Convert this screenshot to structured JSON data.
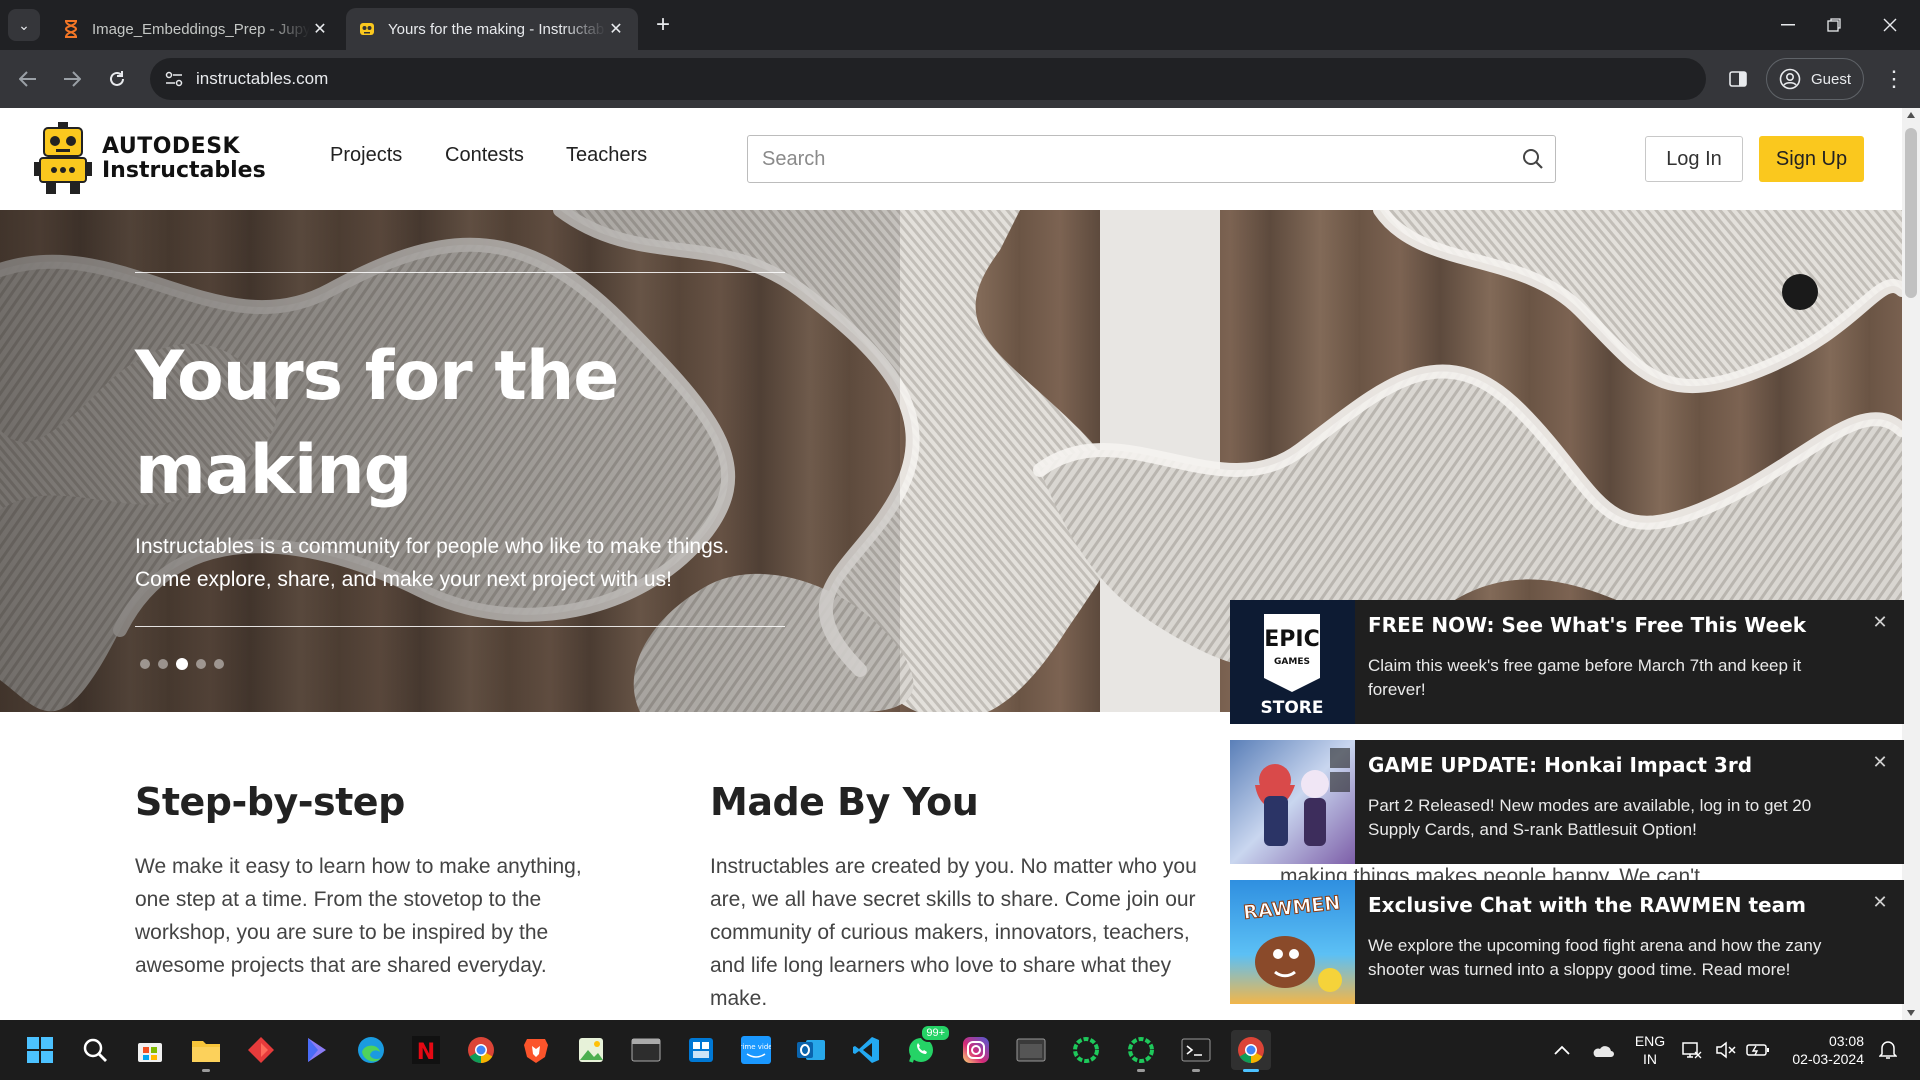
{
  "browser": {
    "tabs": [
      {
        "title": "Image_Embeddings_Prep - Jupyter",
        "active": false
      },
      {
        "title": "Yours for the making - Instructables",
        "active": true
      }
    ],
    "url": "instructables.com",
    "profile_label": "Guest"
  },
  "site": {
    "logo_top": "AUTODESK",
    "logo_bottom": "Instructables",
    "nav": [
      "Projects",
      "Contests",
      "Teachers"
    ],
    "search_placeholder": "Search",
    "login_label": "Log In",
    "signup_label": "Sign Up",
    "accent_color": "#fac81e"
  },
  "hero": {
    "title": "Yours for the making",
    "subtitle_line1": "Instructables is a community for people who like to make things.",
    "subtitle_line2": "Come explore, share, and make your next project with us!",
    "slides": 5,
    "active_slide": 3
  },
  "features": [
    {
      "title": "Step-by-step",
      "text": "We make it easy to learn how to make anything, one step at a time. From the stovetop to the workshop, you are sure to be inspired by the awesome projects that are shared everyday."
    },
    {
      "title": "Made By You",
      "text": "Instructables are created by you. No matter who you are, we all have secret skills to share. Come join our community of curious makers, innovators, teachers, and life long learners who love to share what they make."
    },
    {
      "title": "",
      "text": "making things makes people happy. We can't"
    }
  ],
  "notifications": [
    {
      "title": "FREE NOW: See What's Free This Week",
      "text": "Claim this week's free game before March 7th and keep it forever!",
      "thumb_top": "EPIC",
      "thumb_mid": "GAMES",
      "thumb_bottom": "STORE"
    },
    {
      "title": "GAME UPDATE: Honkai Impact 3rd",
      "text": "Part 2 Released! New modes are available, log in to get 20 Supply Cards, and S-rank Battlesuit Option!"
    },
    {
      "title": "Exclusive Chat with the RAWMEN team",
      "text": "We explore the upcoming food fight arena and how the zany shooter was turned into a sloppy good time. Read more!",
      "thumb_label": "RAWMEN"
    }
  ],
  "taskbar": {
    "apps": [
      "start-icon",
      "search-icon",
      "store-icon",
      "file-explorer-icon",
      "app-red-icon",
      "app-purple-icon",
      "edge-icon",
      "netflix-icon",
      "chrome-icon",
      "brave-icon",
      "photos-icon",
      "terminal-icon",
      "windows-app-icon",
      "prime-video-icon",
      "outlook-icon",
      "vscode-icon",
      "whatsapp-icon",
      "instagram-icon",
      "window-app-icon",
      "green-ring-icon",
      "green-ring-2-icon",
      "cmd-icon",
      "chrome-active-icon"
    ],
    "whatsapp_badge": "99+",
    "netflix_letter": "N",
    "prime_label": "prime video",
    "lang_line1": "ENG",
    "lang_line2": "IN",
    "time": "03:08",
    "date": "02-03-2024"
  }
}
